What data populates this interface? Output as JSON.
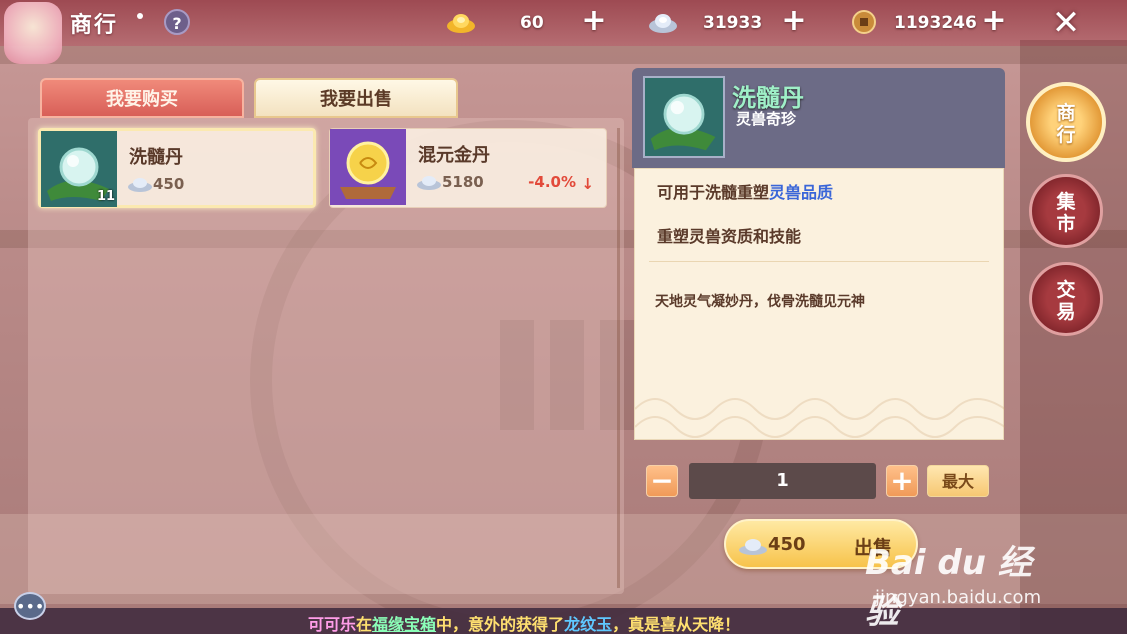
{
  "header": {
    "title": "商行",
    "help_label": "?",
    "currencies": [
      {
        "icon": "gold-ingot-icon",
        "value": "60"
      },
      {
        "icon": "silver-ingot-icon",
        "value": "31933"
      },
      {
        "icon": "copper-coin-icon",
        "value": "1193246"
      }
    ],
    "plus_label": "+",
    "close_icon": "close-icon"
  },
  "tabs": [
    {
      "label": "我要购买",
      "active": false
    },
    {
      "label": "我要出售",
      "active": true
    }
  ],
  "items": [
    {
      "name": "洗髓丹",
      "price": "450",
      "count": "11",
      "icon": "jade-orb-icon",
      "selected": true
    },
    {
      "name": "混元金丹",
      "price": "5180",
      "change": "-4.0%",
      "icon": "golden-orb-icon",
      "selected": false
    }
  ],
  "detail": {
    "name": "洗髓丹",
    "type": "灵兽奇珍",
    "line1_prefix": "可用于洗髓重塑",
    "line1_highlight": "灵兽品质",
    "line2": "重塑灵兽资质和技能",
    "flavor": "天地灵气凝妙丹，伐骨洗髓见元神"
  },
  "quantity": {
    "minus_label": "−",
    "value": "1",
    "plus_label": "+",
    "max_label": "最大"
  },
  "sell": {
    "price": "450",
    "label": "出售"
  },
  "side_nav": [
    {
      "label": "商行",
      "active": true
    },
    {
      "label": "集市",
      "active": false
    },
    {
      "label": "交易",
      "active": false
    }
  ],
  "ticker": {
    "name": "可可乐",
    "part1": "在",
    "box": "福缘宝箱",
    "part2": "中，意外的获得了",
    "item": "龙纹玉",
    "part3": "，真是喜从天降！"
  },
  "watermark": {
    "logo": "Bai du 经验",
    "url": "jingyan.baidu.com"
  },
  "colors": {
    "accent_red": "#d85f58",
    "gold": "#f7c34b",
    "price_down": "#e24a3a",
    "highlight_blue": "#3a66d8"
  }
}
